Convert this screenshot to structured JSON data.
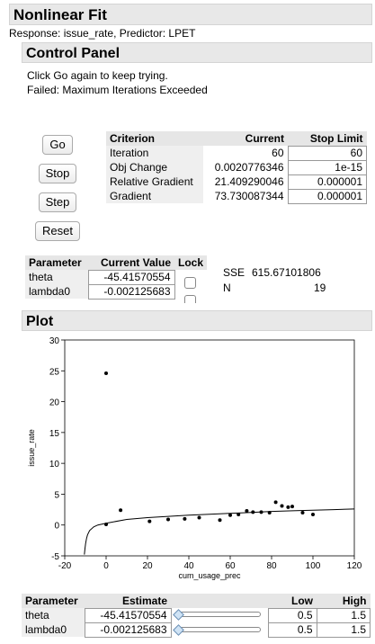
{
  "title": "Nonlinear Fit",
  "response_line": "Response: issue_rate, Predictor: LPET",
  "control_panel": {
    "title": "Control Panel",
    "message1": "Click Go again to keep trying.",
    "message2": "Failed: Maximum Iterations Exceeded",
    "buttons": {
      "go": "Go",
      "stop": "Stop",
      "step": "Step",
      "reset": "Reset"
    },
    "criterion_table": {
      "headers": [
        "Criterion",
        "Current",
        "Stop Limit"
      ],
      "rows": [
        {
          "label": "Iteration",
          "current": "60",
          "limit": "60"
        },
        {
          "label": "Obj Change",
          "current": "0.0020776346",
          "limit": "1e-15"
        },
        {
          "label": "Relative Gradient",
          "current": "21.409290046",
          "limit": "0.000001"
        },
        {
          "label": "Gradient",
          "current": "73.730087344",
          "limit": "0.000001"
        }
      ]
    },
    "param_table": {
      "headers": [
        "Parameter",
        "Current Value",
        "Lock"
      ],
      "rows": [
        {
          "name": "theta",
          "value": "-45.41570554"
        },
        {
          "name": "lambda0",
          "value": "-0.002125683"
        }
      ]
    },
    "sse_label": "SSE",
    "sse_value": "615.67101806",
    "n_label": "N",
    "n_value": "19"
  },
  "plot": {
    "title": "Plot"
  },
  "chart_data": {
    "type": "scatter",
    "xlabel": "cum_usage_prec",
    "ylabel": "issue_rate",
    "xlim": [
      -20,
      120
    ],
    "ylim": [
      -5,
      30
    ],
    "x_ticks": [
      -20,
      0,
      20,
      40,
      60,
      80,
      100,
      120
    ],
    "y_ticks": [
      -5,
      0,
      5,
      10,
      15,
      20,
      25,
      30
    ],
    "points": [
      [
        0,
        24.6
      ],
      [
        0,
        0.1
      ],
      [
        7,
        2.4
      ],
      [
        21,
        0.6
      ],
      [
        30,
        0.9
      ],
      [
        38,
        1.0
      ],
      [
        45,
        1.2
      ],
      [
        55,
        0.8
      ],
      [
        60,
        1.6
      ],
      [
        64,
        1.7
      ],
      [
        68,
        2.3
      ],
      [
        71,
        2.1
      ],
      [
        75,
        2.1
      ],
      [
        79,
        2.0
      ],
      [
        82,
        3.7
      ],
      [
        85,
        3.1
      ],
      [
        88,
        2.9
      ],
      [
        90,
        3.0
      ],
      [
        95,
        2.0
      ],
      [
        100,
        1.7
      ]
    ],
    "fit_curve": [
      [
        -10.5,
        -4.8
      ],
      [
        -10.2,
        -3.8
      ],
      [
        -9.9,
        -3.0
      ],
      [
        -9.5,
        -2.2
      ],
      [
        -9,
        -1.6
      ],
      [
        -8,
        -0.9
      ],
      [
        -6,
        -0.3
      ],
      [
        -4,
        0.0
      ],
      [
        0,
        0.3
      ],
      [
        10,
        0.9
      ],
      [
        20,
        1.2
      ],
      [
        30,
        1.4
      ],
      [
        40,
        1.6
      ],
      [
        50,
        1.75
      ],
      [
        60,
        1.9
      ],
      [
        70,
        2.05
      ],
      [
        80,
        2.2
      ],
      [
        90,
        2.3
      ],
      [
        100,
        2.4
      ],
      [
        110,
        2.5
      ],
      [
        120,
        2.6
      ]
    ]
  },
  "estimates": {
    "headers": [
      "Parameter",
      "Estimate",
      "Low",
      "High"
    ],
    "rows": [
      {
        "name": "theta",
        "estimate": "-45.41570554",
        "low": "0.5",
        "high": "1.5"
      },
      {
        "name": "lambda0",
        "estimate": "-0.002125683",
        "low": "0.5",
        "high": "1.5"
      }
    ]
  }
}
